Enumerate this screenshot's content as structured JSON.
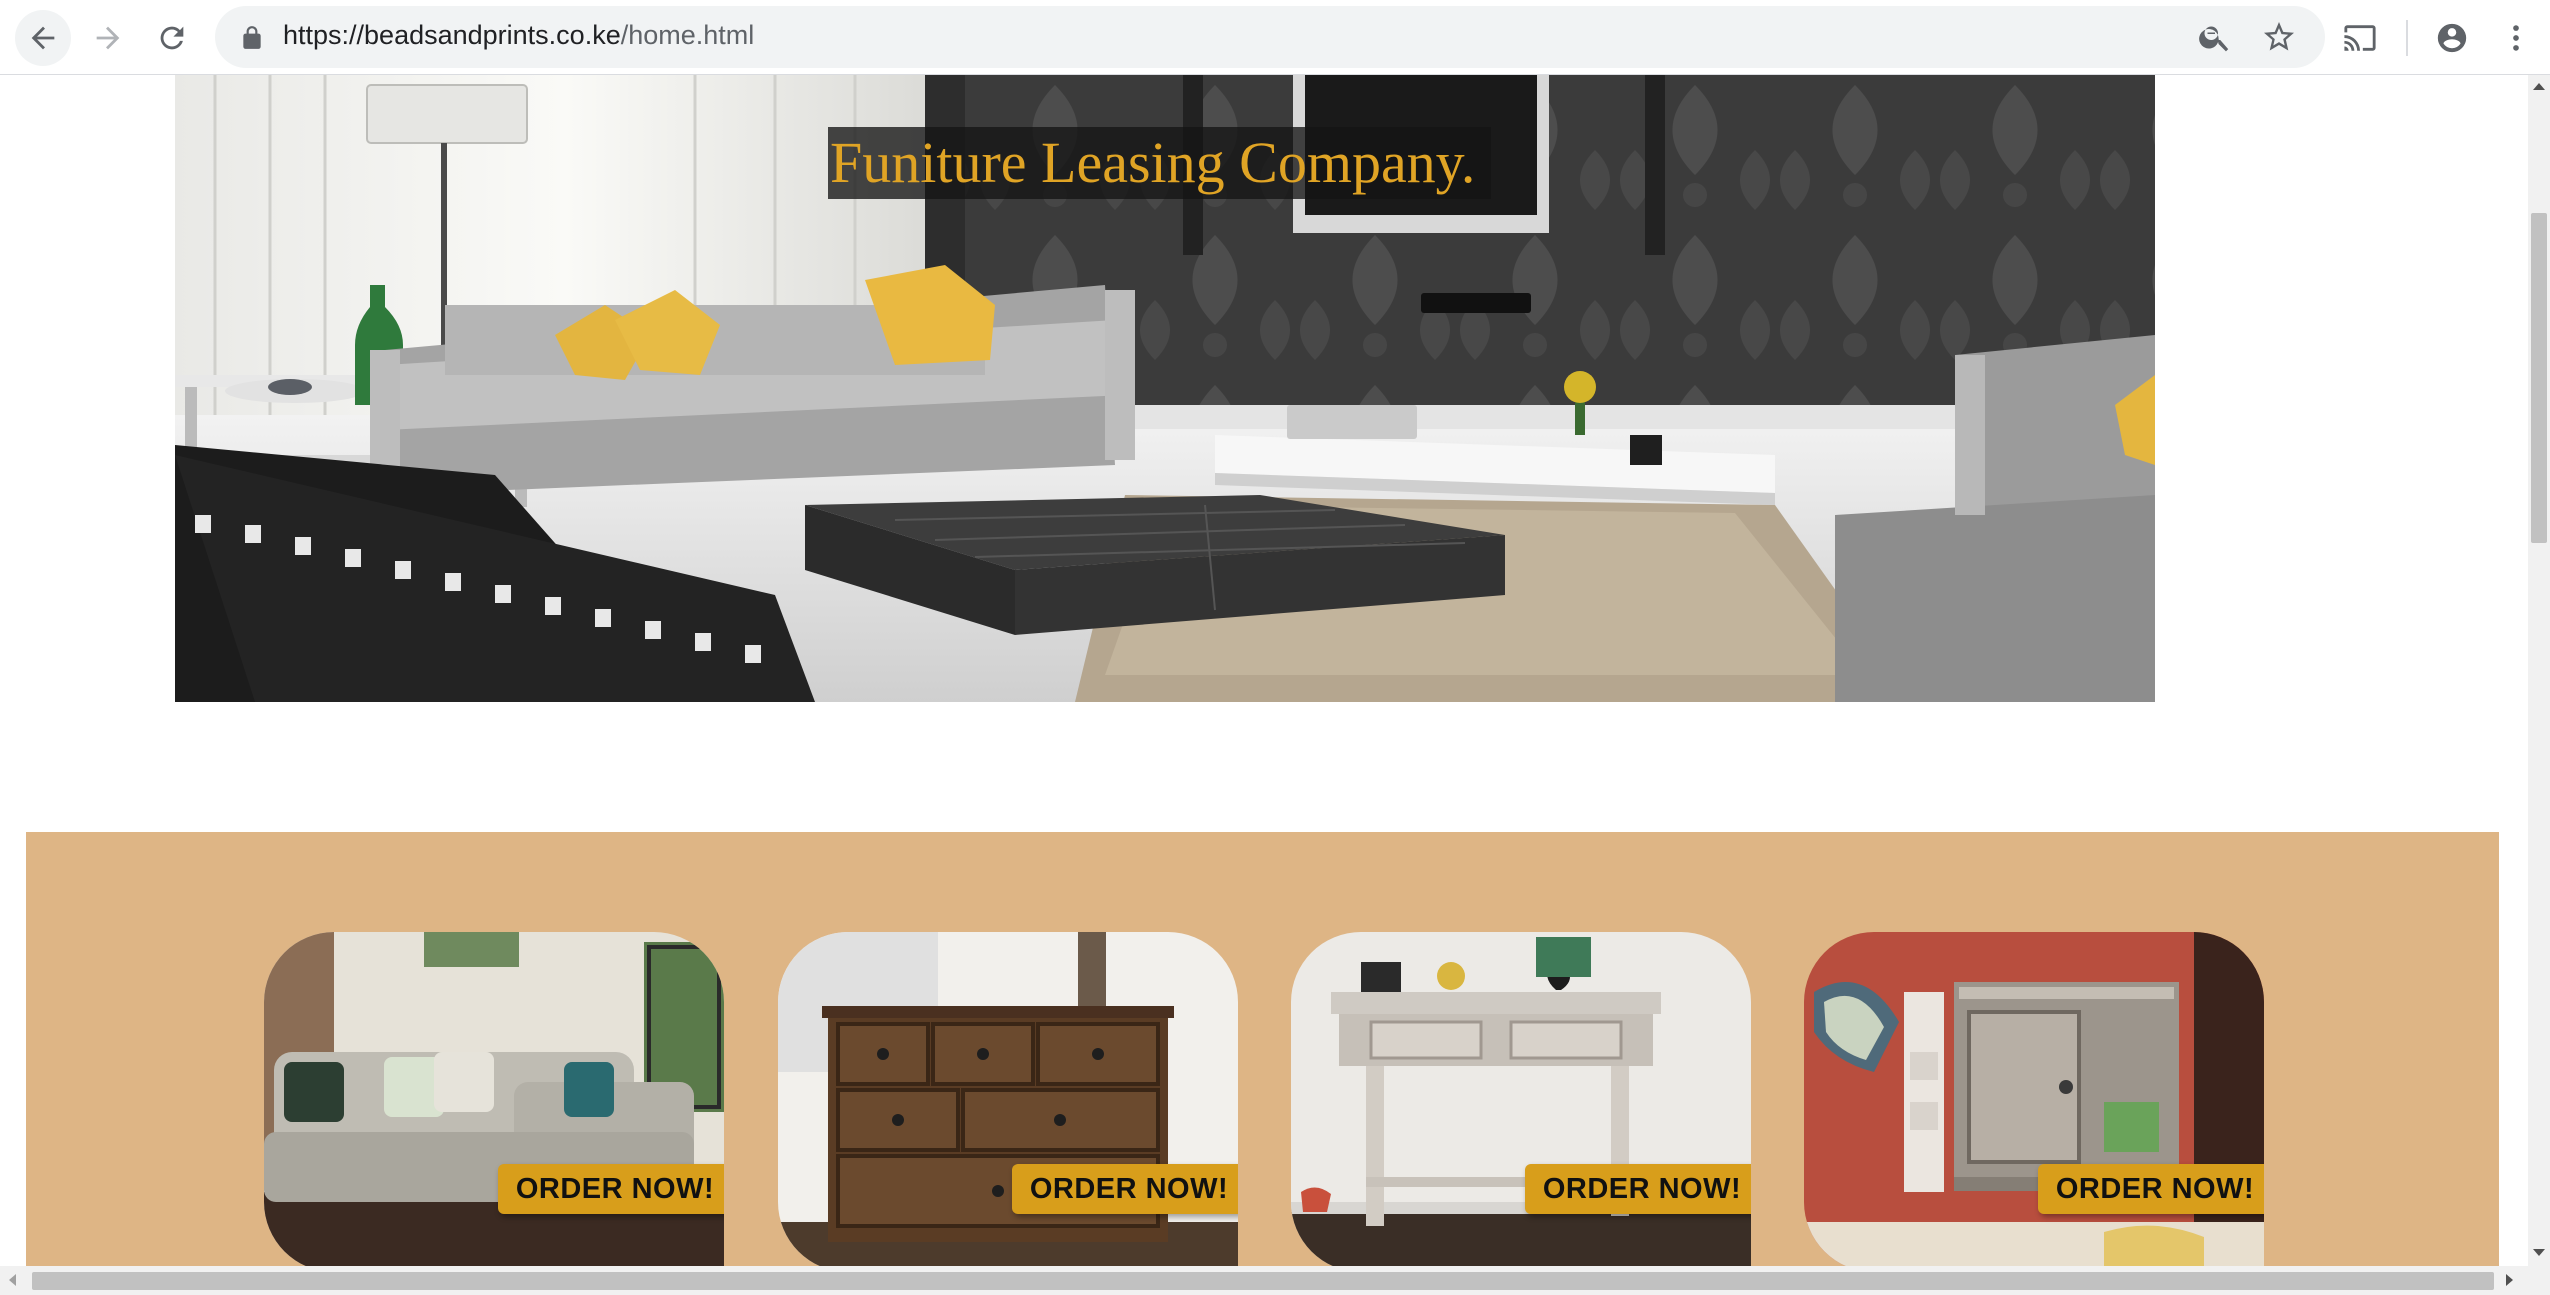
{
  "browser": {
    "url_host": "https://beadsandprints.co.ke",
    "url_path": "/home.html",
    "icons": [
      "back-icon",
      "forward-icon",
      "reload-icon",
      "lock-icon",
      "zoom-icon",
      "star-icon",
      "cast-icon",
      "account-icon",
      "menu-icon"
    ]
  },
  "hero": {
    "title": "Funiture Leasing Company."
  },
  "products": [
    {
      "image": "sofa",
      "button": "ORDER NOW!"
    },
    {
      "image": "dresser",
      "button": "ORDER NOW!"
    },
    {
      "image": "console-table",
      "button": "ORDER NOW!"
    },
    {
      "image": "bedside-cabinet",
      "button": "ORDER NOW!"
    }
  ],
  "colors": {
    "band": "#deb585",
    "button": "#d89e1b",
    "hero_title": "#e0a425"
  }
}
